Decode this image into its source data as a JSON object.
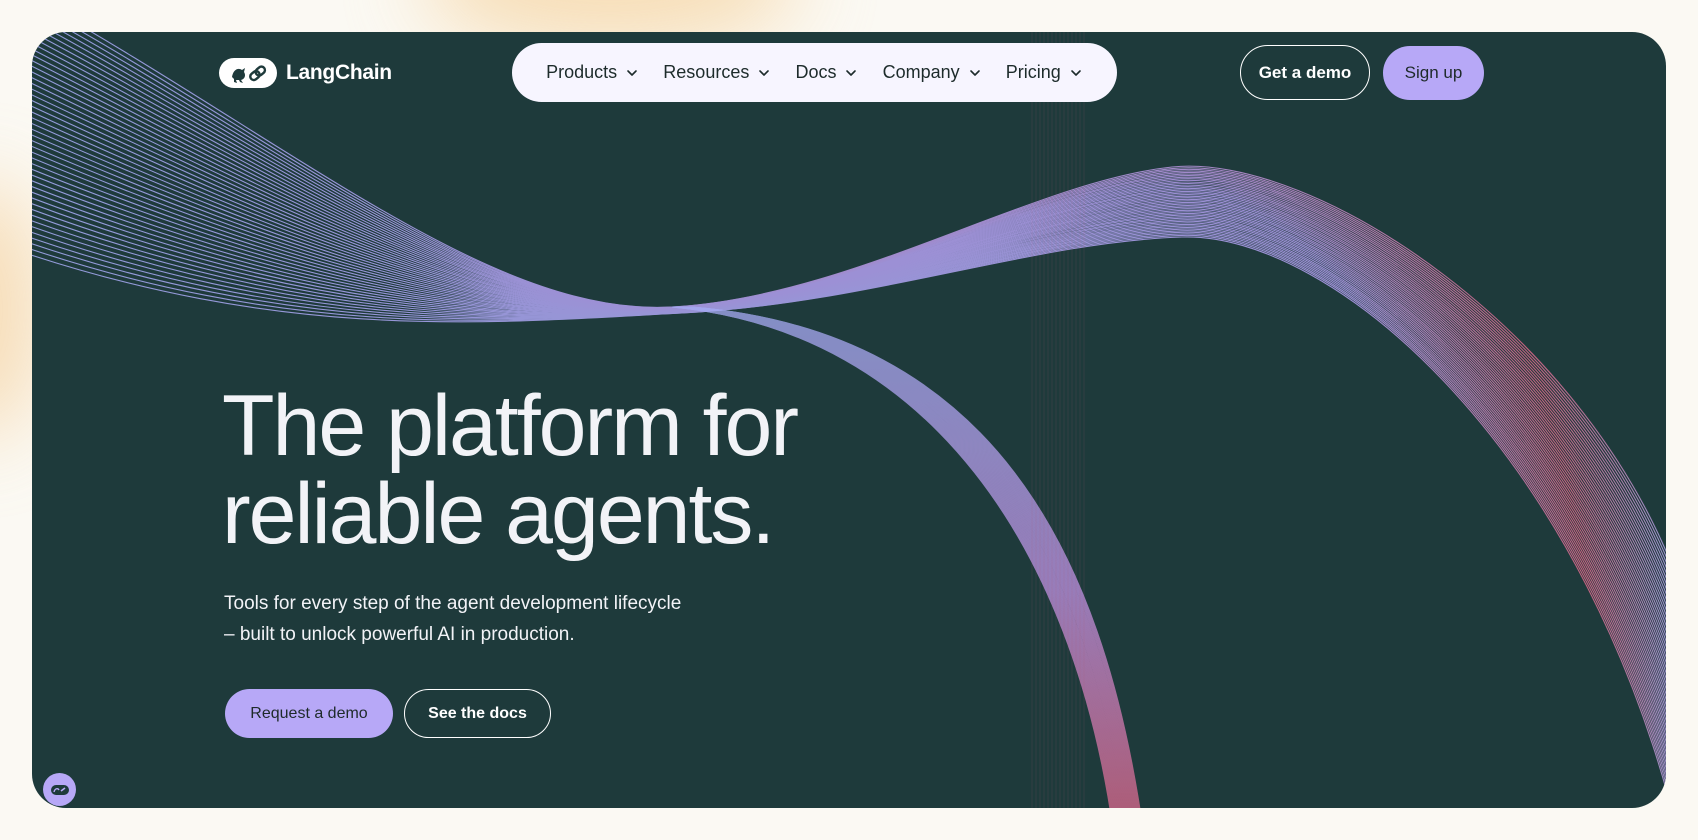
{
  "brand": {
    "name": "LangChain",
    "logo_icon": "parrot-chain-logo-icon"
  },
  "nav": {
    "items": [
      {
        "label": "Products",
        "icon": "chevron-down-icon"
      },
      {
        "label": "Resources",
        "icon": "chevron-down-icon"
      },
      {
        "label": "Docs",
        "icon": "chevron-down-icon"
      },
      {
        "label": "Company",
        "icon": "chevron-down-icon"
      },
      {
        "label": "Pricing",
        "icon": "chevron-down-icon"
      }
    ]
  },
  "header_actions": {
    "demo_label": "Get a demo",
    "signup_label": "Sign up"
  },
  "hero": {
    "headline_line1": "The platform for",
    "headline_line2": "reliable agents.",
    "subtitle_line1": "Tools for every step of the agent development lifecycle",
    "subtitle_line2": "– built to unlock powerful AI in production.",
    "request_demo_label": "Request a demo",
    "docs_label": "See the docs"
  },
  "chat_widget": {
    "icon": "chat-logo-icon"
  },
  "colors": {
    "page_bg": "#fbf9f3",
    "hero_bg": "#1e3a3b",
    "accent_lavender": "#b7a8f7",
    "wave_blue": "#a6acf5",
    "wave_pink": "#e0688a",
    "text_light": "#f2f3f7"
  }
}
